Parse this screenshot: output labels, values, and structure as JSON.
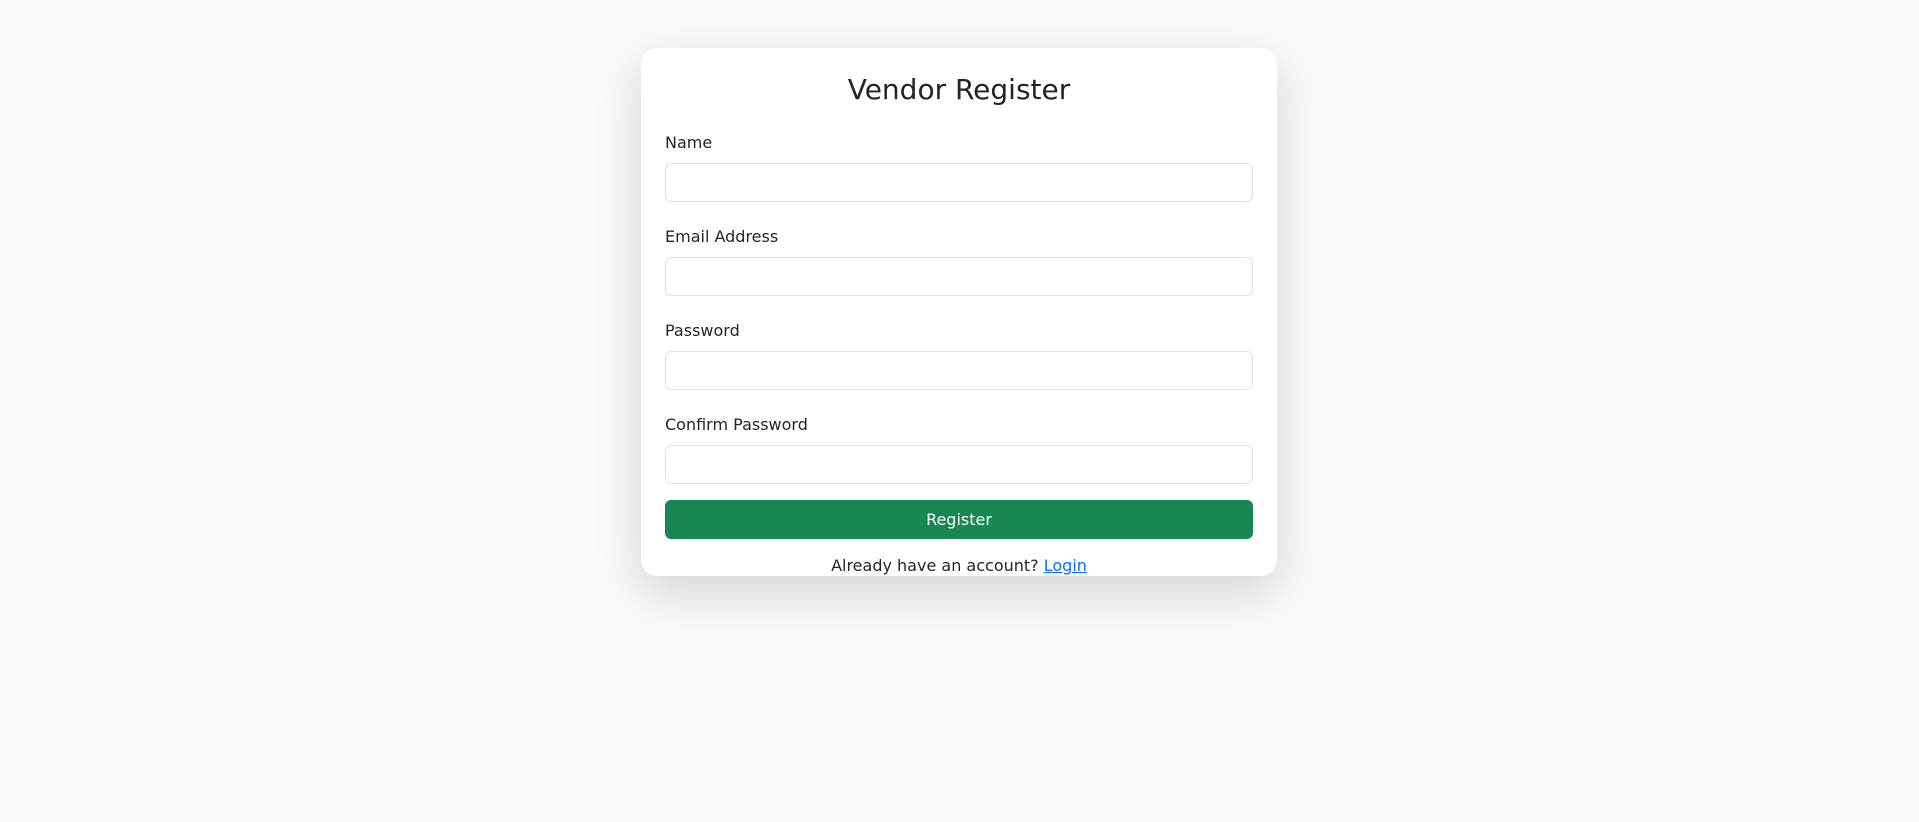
{
  "page": {
    "background": "#f8f9fa"
  },
  "card": {
    "title": "Vendor Register"
  },
  "form": {
    "name": {
      "label": "Name",
      "value": "",
      "placeholder": ""
    },
    "email": {
      "label": "Email Address",
      "value": "",
      "placeholder": ""
    },
    "password": {
      "label": "Password",
      "value": "",
      "placeholder": ""
    },
    "confirm_password": {
      "label": "Confirm Password",
      "value": "",
      "placeholder": ""
    },
    "submit_label": "Register",
    "submit_color": "#198754"
  },
  "footer": {
    "prompt": "Already have an account?",
    "link_label": "Login",
    "link_color": "#0d6efd"
  }
}
